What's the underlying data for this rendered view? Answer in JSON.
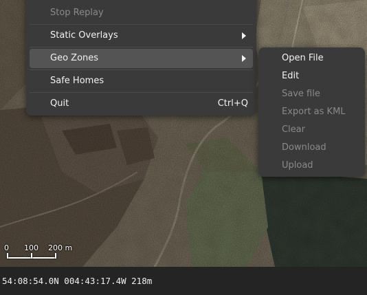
{
  "main_menu": {
    "items": [
      {
        "label": "Stop Replay",
        "disabled": true
      },
      {
        "label": "Static Overlays",
        "submenu": true
      },
      {
        "label": "Geo Zones",
        "submenu": true,
        "highlighted": true
      },
      {
        "label": "Safe Homes"
      },
      {
        "label": "Quit",
        "shortcut": "Ctrl+Q"
      }
    ]
  },
  "geo_zones_menu": {
    "items": [
      {
        "label": "Open File",
        "disabled": false
      },
      {
        "label": "Edit",
        "disabled": false
      },
      {
        "label": "Save file",
        "disabled": true
      },
      {
        "label": "Export as KML",
        "disabled": true
      },
      {
        "label": "Clear",
        "disabled": true
      },
      {
        "label": "Download",
        "disabled": true
      },
      {
        "label": "Upload",
        "disabled": true
      }
    ]
  },
  "scale_bar": {
    "labels": [
      "0",
      "100",
      "200 m"
    ]
  },
  "status_bar": {
    "coordinates": "54:08:54.0N 004:43:17.4W 218m"
  },
  "colors": {
    "menu_bg": "#3a3a3a",
    "menu_highlight": "#545454",
    "menu_text": "#f2f2f2",
    "menu_disabled_text": "#8a8a8a",
    "status_bar_bg": "#242424"
  },
  "icons": [
    "submenu-arrow-icon"
  ]
}
